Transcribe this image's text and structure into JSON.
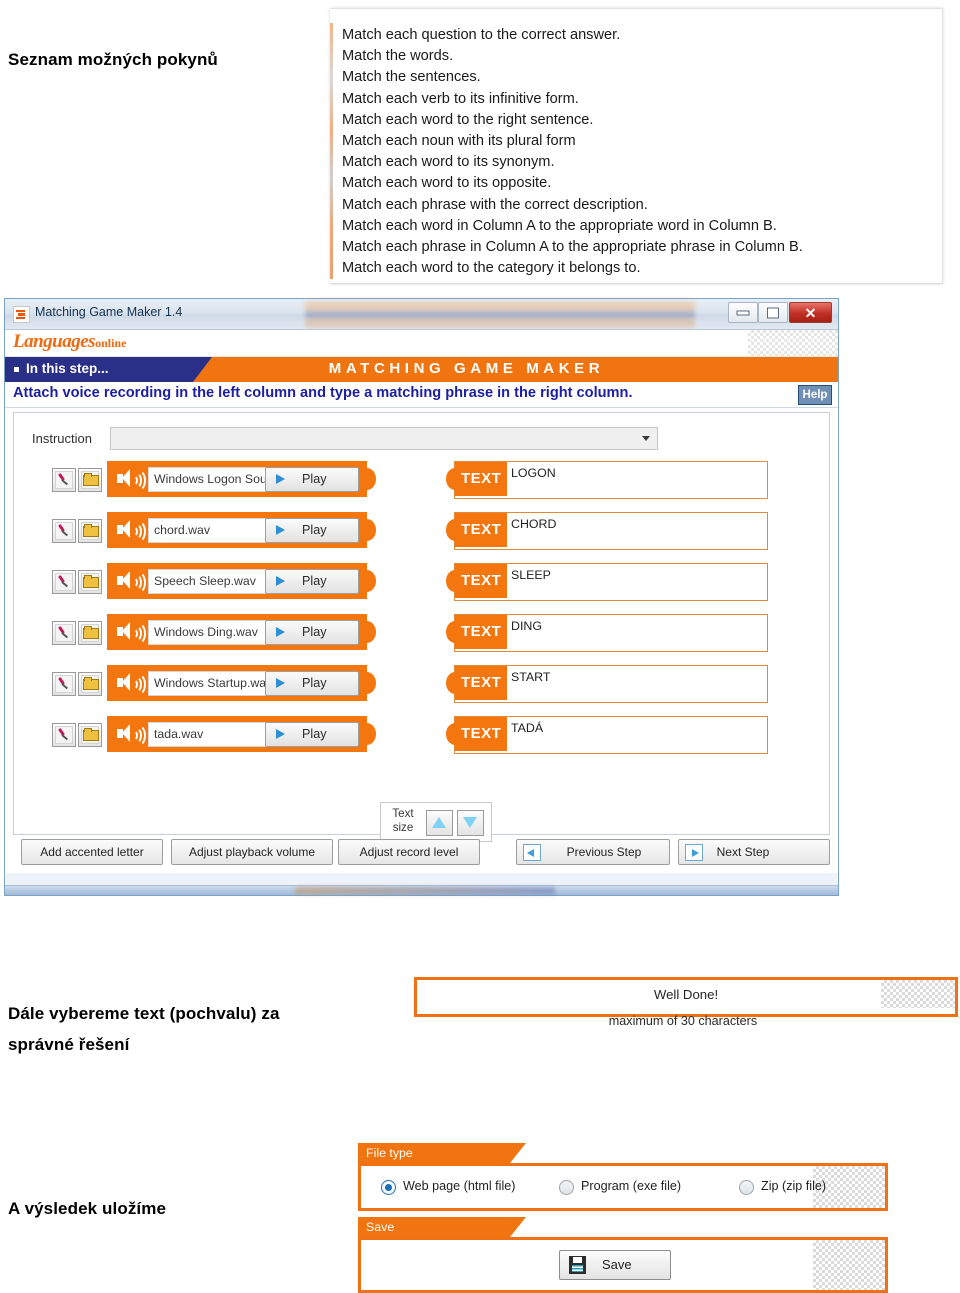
{
  "annotations": {
    "top_label": "Seznam možných pokynů",
    "middle_label_line1": "Dále vybereme text (pochvalu) za",
    "middle_label_line2": "správné řešení",
    "bottom_label": "A výsledek uložíme"
  },
  "instruction_list": {
    "items": [
      "Match each question to the correct answer.",
      "Match the words.",
      "Match the sentences.",
      "Match each verb to its infinitive form.",
      "Match each word to the right sentence.",
      "Match each noun with its plural form",
      "Match each word to its synonym.",
      "Match each word to its opposite.",
      "Match each phrase with the correct description.",
      "Match each word in Column A to the appropriate word in Column B.",
      "Match each phrase in Column A to the appropriate phrase in Column B.",
      "Match each word to the category it belongs to."
    ]
  },
  "app": {
    "title": "Matching Game Maker 1.4",
    "logo_main": "Languages",
    "logo_sub": "online",
    "step_tab": "In this step...",
    "step_title": "MATCHING GAME MAKER",
    "step_description": "Attach voice recording in the left column and type a matching phrase in the right column.",
    "help_label": "Help",
    "window_controls": {
      "minimize": "minimize-icon",
      "maximize": "maximize-icon",
      "close": "✕"
    },
    "instruction_field": {
      "label": "Instruction",
      "value": "",
      "placeholder": ""
    },
    "rows": [
      {
        "file": "Windows Logon Sound.wav",
        "play": "Play",
        "tag": "TEXT",
        "text": "LOGON"
      },
      {
        "file": "chord.wav",
        "play": "Play",
        "tag": "TEXT",
        "text": "CHORD"
      },
      {
        "file": "Speech Sleep.wav",
        "play": "Play",
        "tag": "TEXT",
        "text": "SLEEP"
      },
      {
        "file": "Windows Ding.wav",
        "play": "Play",
        "tag": "TEXT",
        "text": "DING"
      },
      {
        "file": "Windows Startup.wav",
        "play": "Play",
        "tag": "TEXT",
        "text": "START"
      },
      {
        "file": "tada.wav",
        "play": "Play",
        "tag": "TEXT",
        "text": "TADÁ"
      }
    ],
    "text_size": {
      "label_line1": "Text",
      "label_line2": "size",
      "increase": "triangle-up-icon",
      "decrease": "triangle-down-icon"
    },
    "toolbar": {
      "add_accented_letter": "Add accented letter",
      "adjust_playback_volume": "Adjust playback volume",
      "adjust_record_level": "Adjust record level",
      "previous_step": "Previous Step",
      "next_step": "Next Step"
    }
  },
  "welldone": {
    "value": "Well Done!",
    "hint": "maximum of 30 characters"
  },
  "filetype": {
    "title": "File type",
    "options": [
      {
        "label": "Web page (html file)",
        "selected": true
      },
      {
        "label": "Program (exe file)",
        "selected": false
      },
      {
        "label": "Zip (zip file)",
        "selected": false
      }
    ]
  },
  "save": {
    "title": "Save",
    "button_label": "Save"
  },
  "colors": {
    "orange": "#f4760e",
    "panel_orange": "#ef7114",
    "navy": "#2a2f88",
    "step_text": "#1b1fa0"
  }
}
